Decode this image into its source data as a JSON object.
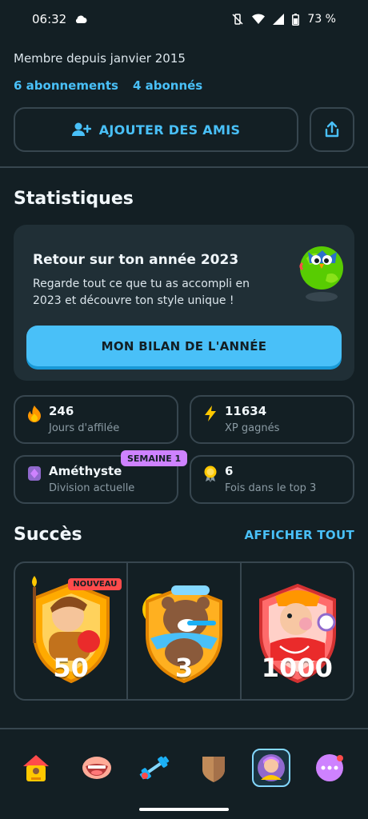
{
  "status": {
    "time": "06:32",
    "battery": "73 %"
  },
  "profile": {
    "member_since": "Membre depuis janvier 2015",
    "following": "6 abonnements",
    "followers": "4 abonnés",
    "add_friends_label": "AJOUTER DES AMIS"
  },
  "stats": {
    "heading": "Statistiques",
    "promo": {
      "title": "Retour sur ton année 2023",
      "text": "Regarde tout ce que tu as accompli en 2023 et découvre ton style unique !",
      "button": "MON BILAN DE L'ANNÉE"
    },
    "cards": [
      {
        "value": "246",
        "label": "Jours d'affilée",
        "icon": "flame-icon"
      },
      {
        "value": "11634",
        "label": "XP gagnés",
        "icon": "lightning-icon"
      },
      {
        "value": "Améthyste",
        "label": "Division actuelle",
        "icon": "league-gem-icon",
        "badge": "SEMAINE 1"
      },
      {
        "value": "6",
        "label": "Fois dans le top 3",
        "icon": "medal-icon"
      }
    ]
  },
  "achievements": {
    "heading": "Succès",
    "see_all": "AFFICHER TOUT",
    "items": [
      {
        "number": "50",
        "badge": "NOUVEAU",
        "icon": "scholar-achievement-icon"
      },
      {
        "number": "3",
        "icon": "bear-achievement-icon"
      },
      {
        "number": "1000",
        "icon": "referee-achievement-icon"
      }
    ]
  },
  "tabs": [
    {
      "icon": "home-icon"
    },
    {
      "icon": "speaking-mouth-icon"
    },
    {
      "icon": "dumbbell-icon"
    },
    {
      "icon": "shield-icon"
    },
    {
      "icon": "profile-avatar-icon",
      "active": true
    },
    {
      "icon": "more-icon"
    }
  ],
  "colors": {
    "accent": "#49c0f8",
    "background": "#131f24",
    "card": "#202f36",
    "border": "#37464f",
    "amethyst": "#ce82ff"
  }
}
